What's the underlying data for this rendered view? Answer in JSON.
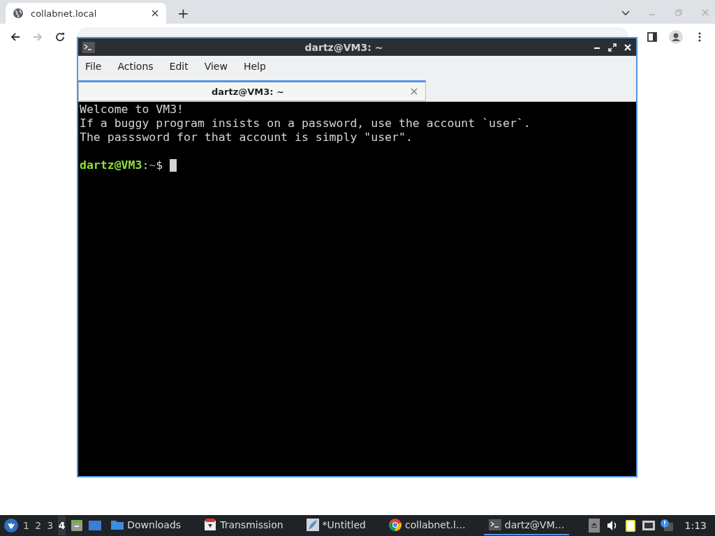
{
  "browser": {
    "tabs": [
      {
        "title": "collabnet.local",
        "selected": true
      }
    ],
    "new_tab": "+"
  },
  "terminal": {
    "title": "dartz@VM3: ~",
    "menu": [
      "File",
      "Actions",
      "Edit",
      "View",
      "Help"
    ],
    "tabs": [
      {
        "label": "dartz@VM3: ~",
        "selected": true
      }
    ],
    "output": [
      "Welcome to VM3!",
      "If a buggy program insists on a password, use the account `user`.",
      "The passsword for that account is simply \"user\"."
    ],
    "prompt": {
      "user_host": "dartz@VM3",
      "separator": ":",
      "path": "~",
      "symbol": "$"
    }
  },
  "taskbar": {
    "workspaces": [
      {
        "label": "1",
        "selected": false
      },
      {
        "label": "2",
        "selected": false
      },
      {
        "label": "3",
        "selected": false
      },
      {
        "label": "4",
        "selected": true
      }
    ],
    "tasks": [
      {
        "kind": "folder",
        "label": "Downloads",
        "selected": false
      },
      {
        "kind": "transmission",
        "label": "Transmission",
        "selected": false
      },
      {
        "kind": "editor",
        "label": "*Untitled",
        "selected": false
      },
      {
        "kind": "chrome",
        "label": "collabnet.l…",
        "selected": false
      },
      {
        "kind": "terminal",
        "label": "dartz@VM…",
        "selected": true
      }
    ],
    "clock": "1:13"
  }
}
